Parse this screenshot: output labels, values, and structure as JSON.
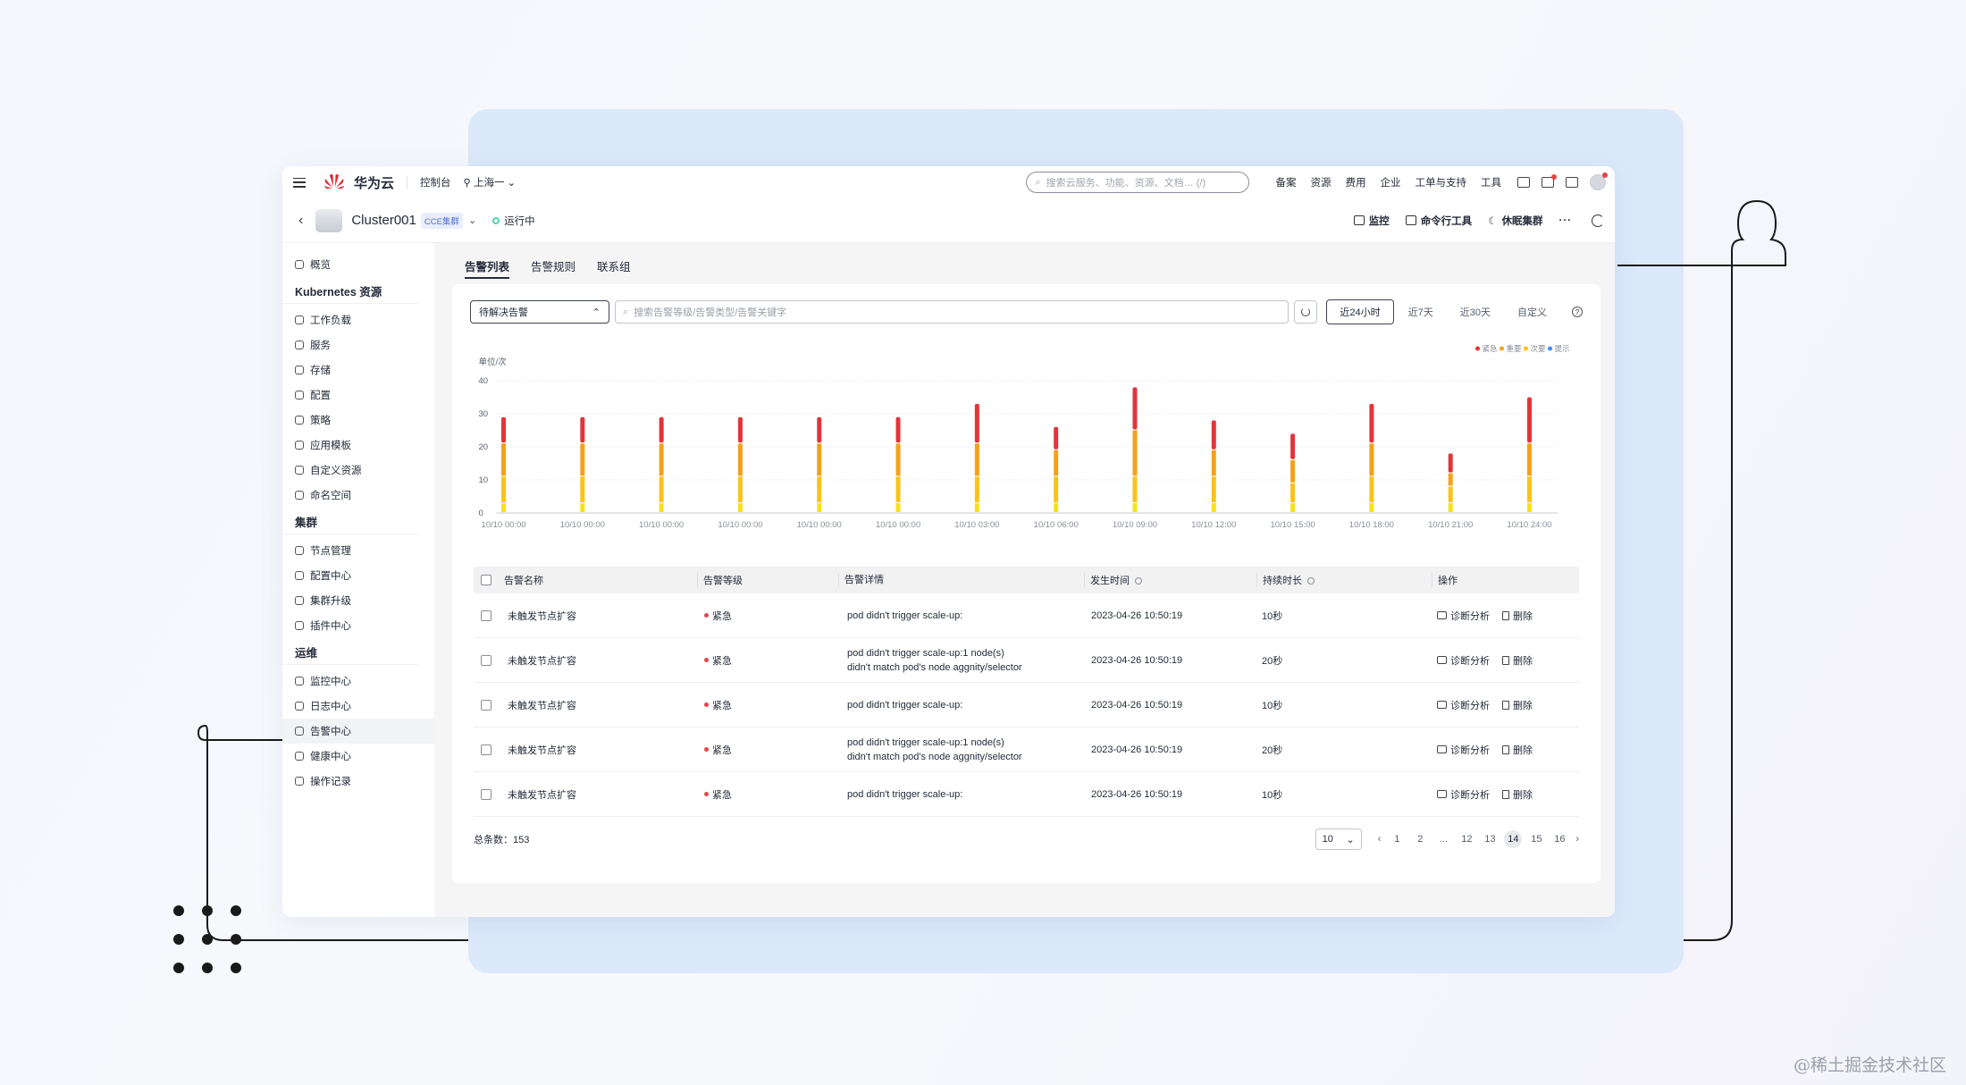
{
  "watermark": "@稀土掘金技术社区",
  "topnav": {
    "brand": "华为云",
    "console": "控制台",
    "region": "上海一",
    "search_placeholder": "搜索云服务、功能、资源、文档… (/)",
    "links": [
      "备案",
      "资源",
      "费用",
      "企业",
      "工单与支持",
      "工具"
    ]
  },
  "cluster": {
    "name": "Cluster001",
    "tag": "CCE集群",
    "status": "运行中",
    "status_color": "#50d4ab",
    "actions": [
      "监控",
      "命令行工具",
      "休眠集群"
    ]
  },
  "sidebar": {
    "overview": "概览",
    "groups": [
      {
        "title": "Kubernetes 资源",
        "items": [
          "工作负载",
          "服务",
          "存储",
          "配置",
          "策略",
          "应用模板",
          "自定义资源",
          "命名空间"
        ]
      },
      {
        "title": "集群",
        "items": [
          "节点管理",
          "配置中心",
          "集群升级",
          "插件中心"
        ]
      },
      {
        "title": "运维",
        "items": [
          "监控中心",
          "日志中心",
          "告警中心",
          "健康中心",
          "操作记录"
        ]
      }
    ],
    "active": "告警中心"
  },
  "tabs": [
    "告警列表",
    "告警规则",
    "联系组"
  ],
  "filters": {
    "select_value": "待解决告警",
    "search_placeholder": "搜索告警等级/告警类型/告警关键字",
    "ranges": [
      "近24小时",
      "近7天",
      "近30天",
      "自定义"
    ],
    "active_range": "近24小时"
  },
  "chart_data": {
    "type": "bar",
    "stacked": true,
    "ylabel": "单位/次",
    "ylim": [
      0,
      40
    ],
    "yticks": [
      0,
      10,
      20,
      30,
      40
    ],
    "legend_position": "top-right",
    "categories": [
      "10/10 00:00",
      "10/10 00:00",
      "10/10 00:00",
      "10/10 00:00",
      "10/10 00:00",
      "10/10 00:00",
      "10/10 03:00",
      "10/10 06:00",
      "10/10 09:00",
      "10/10 12:00",
      "10/10 15:00",
      "10/10 18:00",
      "10/10 21:00",
      "10/10 24:00"
    ],
    "series": [
      {
        "name": "提示",
        "color": "#f7e11a",
        "values": [
          3,
          3,
          3,
          3,
          3,
          3,
          3,
          3,
          3,
          3,
          3,
          3,
          3,
          3
        ]
      },
      {
        "name": "次要",
        "color": "#fbc21a",
        "values": [
          8,
          8,
          8,
          8,
          8,
          8,
          8,
          8,
          8,
          8,
          6,
          8,
          5,
          8
        ]
      },
      {
        "name": "重要",
        "color": "#f4a11a",
        "values": [
          10,
          10,
          10,
          10,
          10,
          10,
          10,
          8,
          14,
          8,
          7,
          10,
          4,
          10
        ]
      },
      {
        "name": "紧急",
        "color": "#e5333a",
        "values": [
          8,
          8,
          8,
          8,
          8,
          8,
          12,
          7,
          13,
          9,
          8,
          12,
          6,
          14
        ]
      }
    ],
    "legend": [
      "紧急",
      "重要",
      "次要",
      "提示"
    ],
    "legend_colors": [
      "#e5333a",
      "#f4a11a",
      "#fbc21a",
      "#3e8ef7"
    ]
  },
  "table": {
    "headers": [
      "告警名称",
      "告警等级",
      "告警详情",
      "发生时间",
      "持续时长",
      "操作"
    ],
    "rows": [
      {
        "name": "未触发节点扩容",
        "level": "紧急",
        "detail1": "pod didn't trigger scale-up:",
        "detail2": "",
        "time": "2023-04-26 10:50:19",
        "duration": "10秒"
      },
      {
        "name": "未触发节点扩容",
        "level": "紧急",
        "detail1": "pod didn't trigger scale-up:1 node(s)",
        "detail2": "didn't match pod's node aggnity/selector",
        "time": "2023-04-26 10:50:19",
        "duration": "20秒"
      },
      {
        "name": "未触发节点扩容",
        "level": "紧急",
        "detail1": "pod didn't trigger scale-up:",
        "detail2": "",
        "time": "2023-04-26 10:50:19",
        "duration": "10秒"
      },
      {
        "name": "未触发节点扩容",
        "level": "紧急",
        "detail1": "pod didn't trigger scale-up:1 node(s)",
        "detail2": "didn't match pod's node aggnity/selector",
        "time": "2023-04-26 10:50:19",
        "duration": "20秒"
      },
      {
        "name": "未触发节点扩容",
        "level": "紧急",
        "detail1": "pod didn't trigger scale-up:",
        "detail2": "",
        "time": "2023-04-26 10:50:19",
        "duration": "10秒"
      }
    ],
    "op_diagnose": "诊断分析",
    "op_delete": "删除"
  },
  "footer": {
    "total_label": "总条数：153",
    "page_size": "10",
    "pages": [
      "1",
      "2",
      "...",
      "12",
      "13",
      "14",
      "15",
      "16"
    ],
    "current_page": "14"
  }
}
